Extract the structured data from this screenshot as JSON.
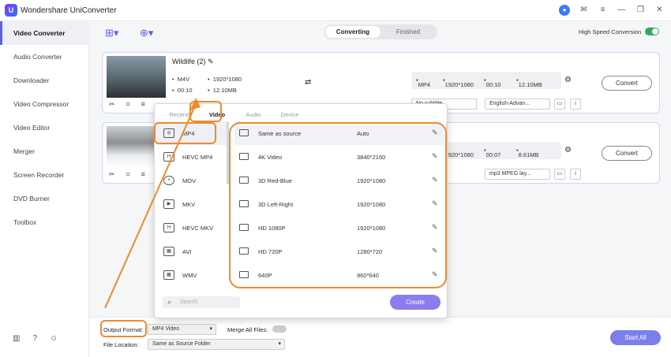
{
  "app": {
    "title": "Wonders hare UniConverter",
    "logo": "U"
  },
  "window_icons": [
    "user-icon",
    "mail-icon",
    "menu-icon",
    "minimize-icon",
    "maximize-icon",
    "close-icon"
  ],
  "sidebar": {
    "items": [
      {
        "label": "Video Converter"
      },
      {
        "label": "Audio Converter"
      },
      {
        "label": "Downloader"
      },
      {
        "label": "Video Compressor"
      },
      {
        "label": "Video Editor"
      },
      {
        "label": "Merger"
      },
      {
        "label": "Screen Recorder"
      },
      {
        "label": "DVD Burner"
      },
      {
        "label": "Toolbox"
      }
    ]
  },
  "tabs": {
    "converting": "Converting",
    "finished": "Finished"
  },
  "high_speed": "High Speed Conversion",
  "file1": {
    "name": "Wildlife (2)",
    "format": "M4V",
    "resolution": "1920*1080",
    "duration": "00:10",
    "size": "12.10MB",
    "out_format": "MP4",
    "out_resolution": "1920*1080",
    "out_duration": "00:10",
    "out_size": "12.10MB",
    "subtitle": "No subtitle",
    "audio": "English-Advan..."
  },
  "file2": {
    "out_resolution": "1920*1080",
    "out_duration": "00:07",
    "out_size": "8.61MB",
    "audio": "mp3 MPEG lay..."
  },
  "convert_label": "Convert",
  "popup": {
    "tabs": [
      "Recently",
      "Video",
      "Audio",
      "Device"
    ],
    "formats": [
      "MP4",
      "HEVC MP4",
      "MOV",
      "MKV",
      "HEVC MKV",
      "AVI",
      "WMV"
    ],
    "resolutions": [
      {
        "name": "Same as source",
        "res": "Auto"
      },
      {
        "name": "4K Video",
        "res": "3840*2160"
      },
      {
        "name": "3D Red-Blue",
        "res": "1920*1080"
      },
      {
        "name": "3D Left-Right",
        "res": "1920*1080"
      },
      {
        "name": "HD 1080P",
        "res": "1920*1080"
      },
      {
        "name": "HD 720P",
        "res": "1280*720"
      },
      {
        "name": "640P",
        "res": "960*640"
      }
    ],
    "search_placeholder": "Search",
    "create": "Create"
  },
  "bottom": {
    "output_format_label": "Output Format:",
    "output_format_value": "MP4 Video",
    "merge_label": "Merge All Files:",
    "file_location_label": "File Location:",
    "file_location_value": "Same as Source Folder",
    "start_all": "Start All"
  }
}
